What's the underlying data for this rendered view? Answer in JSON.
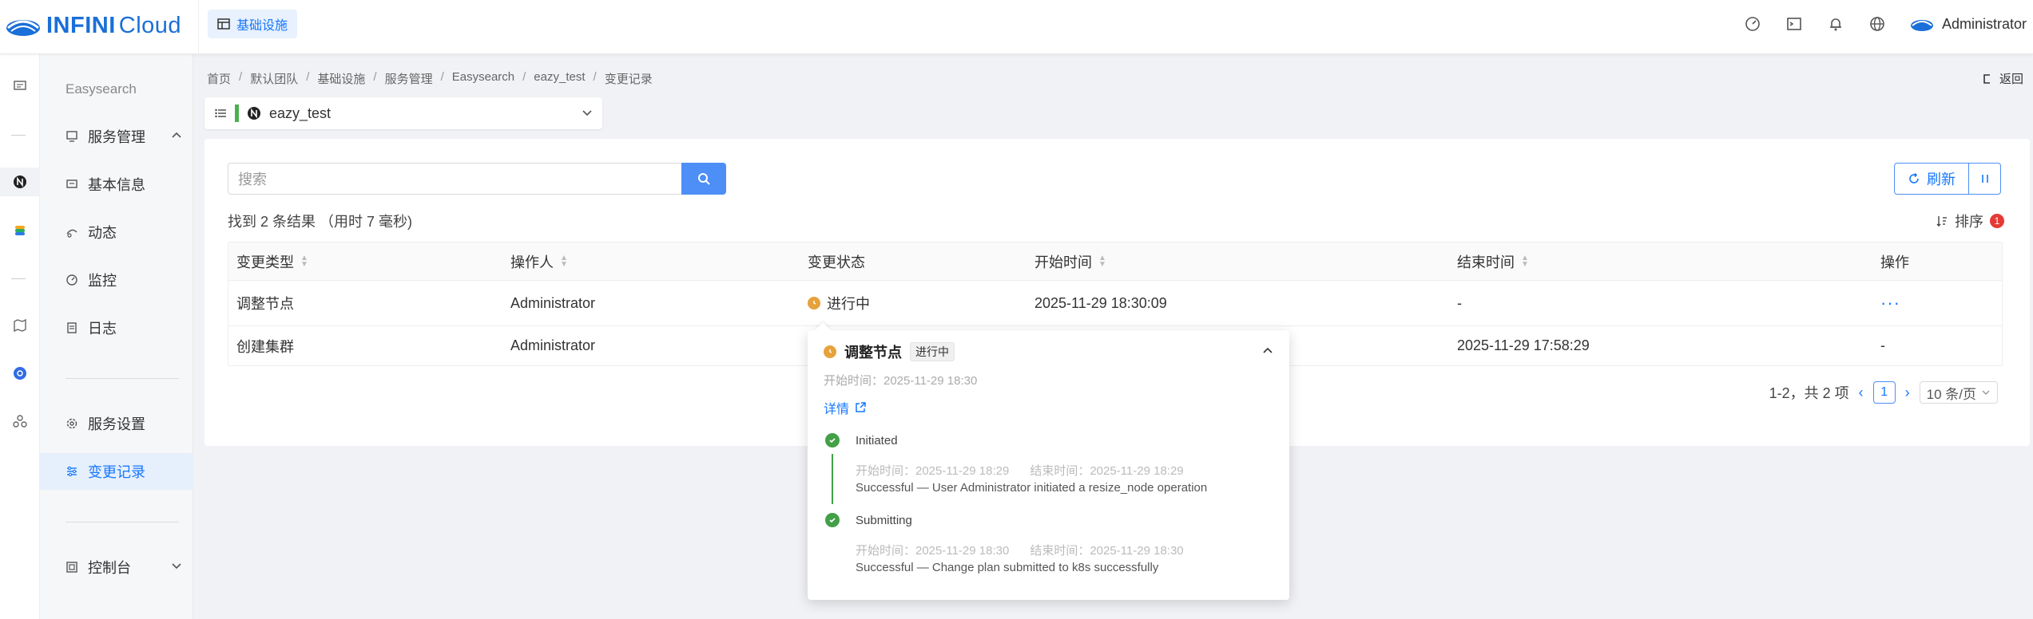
{
  "brand": {
    "name_bold": "INFINI",
    "name_light": "Cloud"
  },
  "header": {
    "tab_label": "基础设施",
    "user_name": "Administrator"
  },
  "sidebar": {
    "section_title": "Easysearch",
    "items": [
      {
        "label": "服务管理",
        "icon": "server-icon"
      },
      {
        "label": "基本信息",
        "icon": "info-icon"
      },
      {
        "label": "动态",
        "icon": "activity-icon"
      },
      {
        "label": "监控",
        "icon": "monitor-icon"
      },
      {
        "label": "日志",
        "icon": "log-icon"
      },
      {
        "label": "服务设置",
        "icon": "gear-icon"
      },
      {
        "label": "变更记录",
        "icon": "changelog-icon"
      },
      {
        "label": "控制台",
        "icon": "console-icon"
      }
    ]
  },
  "breadcrumb": [
    "首页",
    "默认团队",
    "基础设施",
    "服务管理",
    "Easysearch",
    "eazy_test",
    "变更记录"
  ],
  "back_label": "返回",
  "selector": {
    "value": "eazy_test"
  },
  "search": {
    "placeholder": "搜索"
  },
  "toolbar": {
    "refresh_label": "刷新",
    "sort_label": "排序",
    "sort_count": "1"
  },
  "result_count": "找到 2 条结果 （用时 7 毫秒)",
  "table": {
    "headers": [
      "变更类型",
      "操作人",
      "变更状态",
      "开始时间",
      "结束时间",
      "操作"
    ],
    "rows": [
      {
        "type": "调整节点",
        "operator": "Administrator",
        "status": "进行中",
        "start": "2025-11-29 18:30:09",
        "end": "-",
        "action": "···"
      },
      {
        "type": "创建集群",
        "operator": "Administrator",
        "status": "",
        "start": "",
        "end": "2025-11-29 17:58:29",
        "action": "-"
      }
    ]
  },
  "pagination": {
    "summary": "1-2，共 2 项",
    "current_page": "1",
    "page_size": "10 条/页"
  },
  "popover": {
    "title": "调整节点",
    "tag": "进行中",
    "start_time": "开始时间：2025-11-29 18:30",
    "detail_label": "详情",
    "steps": [
      {
        "name": "Initiated",
        "start": "开始时间：2025-11-29 18:29",
        "end": "结束时间：2025-11-29 18:29",
        "message": "Successful — User Administrator initiated a resize_node operation"
      },
      {
        "name": "Submitting",
        "start": "开始时间：2025-11-29 18:30",
        "end": "结束时间：2025-11-29 18:30",
        "message": "Successful — Change plan submitted to k8s successfully"
      }
    ]
  },
  "colors": {
    "accent": "#1677ff",
    "success": "#43a047",
    "warning": "#e6a23c",
    "badge": "#e53935"
  }
}
